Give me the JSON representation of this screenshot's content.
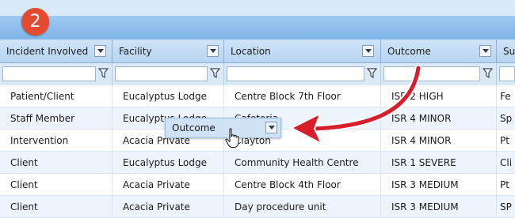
{
  "step_badge": "2",
  "columns": [
    {
      "label": "Incident Involved"
    },
    {
      "label": "Facility"
    },
    {
      "label": "Location"
    },
    {
      "label": "Outcome"
    },
    {
      "label": "Su"
    }
  ],
  "rows": [
    [
      "Patient/Client",
      "Eucalyptus Lodge",
      "Centre Block 7th Floor",
      "ISR 2 HIGH",
      "Fe"
    ],
    [
      "Staff Member",
      "Eucalyptus Lodge",
      "Cafeteria",
      "ISR 4 MINOR",
      "Sp"
    ],
    [
      "Intervention",
      "Acacia Private",
      "Clayton",
      "ISR 4 MINOR",
      "Pt"
    ],
    [
      "Client",
      "Eucalyptus Lodge",
      "Community Health Centre",
      "ISR 1 SEVERE",
      "Cli"
    ],
    [
      "Client",
      "Acacia Private",
      "Centre Block 4th Floor",
      "ISR 3 MEDIUM",
      "Pt"
    ],
    [
      "Client",
      "Acacia Private",
      "Day procedure unit",
      "ISR 3 MEDIUM",
      "SP"
    ]
  ],
  "drag_header": {
    "label": "Outcome"
  },
  "colors": {
    "badge": "#e44a2f",
    "arrow": "#d81e2a",
    "header": "#b7d4f1"
  },
  "icons": [
    "filter-icon",
    "dropdown-arrow-icon",
    "hand-cursor-icon",
    "curved-arrow-icon"
  ]
}
